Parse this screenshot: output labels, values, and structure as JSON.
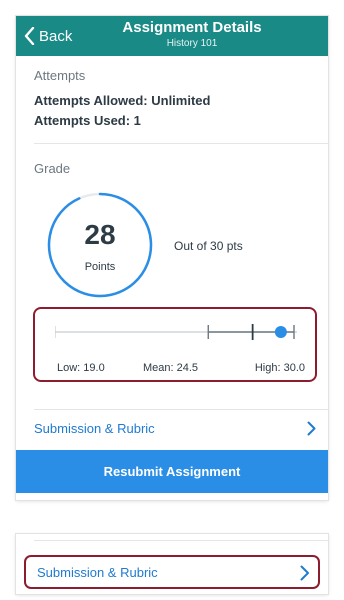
{
  "nav": {
    "back_label": "Back",
    "title": "Assignment Details",
    "subtitle": "History 101"
  },
  "attempts": {
    "section_label": "Attempts",
    "allowed": "Attempts Allowed: Unlimited",
    "used": "Attempts Used: 1"
  },
  "grade": {
    "section_label": "Grade",
    "score": "28",
    "unit": "Points",
    "out_of": "Out of 30 pts",
    "score_value": 28,
    "max_points": 30
  },
  "stats": {
    "low_label": "Low: 19.0",
    "mean_label": "Mean: 24.5",
    "high_label": "High: 30.0",
    "low": 19.0,
    "mean": 24.5,
    "high": 30.0,
    "score": 28
  },
  "links": {
    "submission_rubric": "Submission & Rubric"
  },
  "buttons": {
    "resubmit": "Resubmit Assignment"
  },
  "colors": {
    "nav_bg": "#1a8a86",
    "accent_blue": "#2a8ee6",
    "link_blue": "#1f7ad2",
    "highlight_border": "#8c1d2e"
  },
  "icons": {
    "back": "chevron-left-icon",
    "disclosure": "chevron-right-icon"
  }
}
